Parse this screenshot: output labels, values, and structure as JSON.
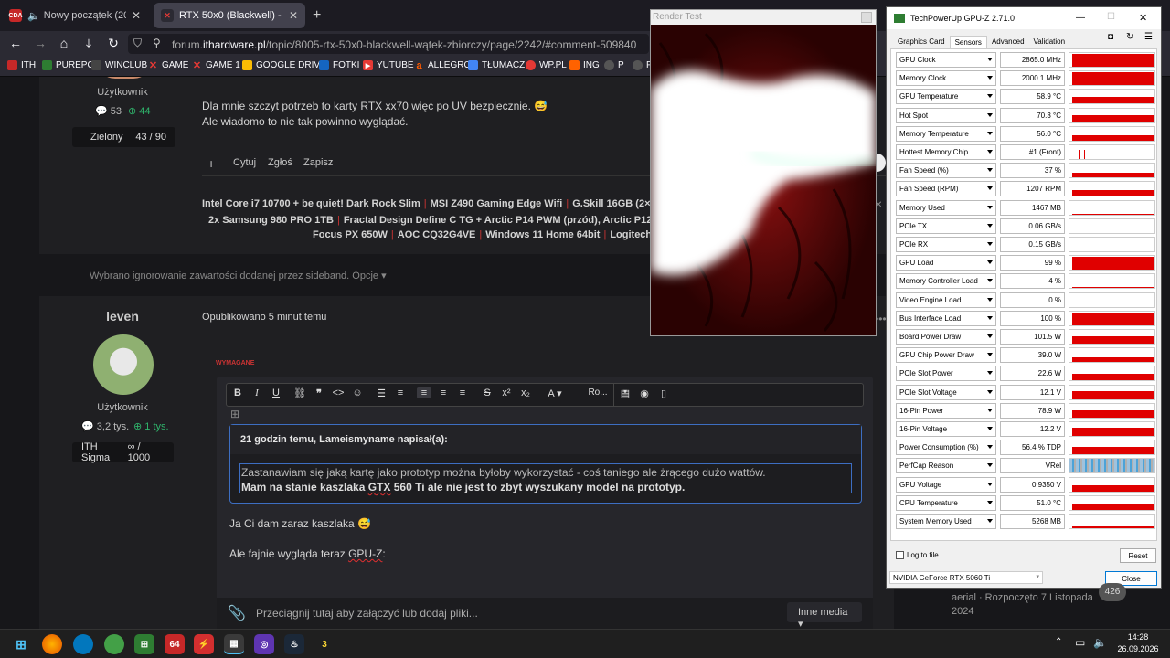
{
  "browser": {
    "tabs": [
      {
        "title": "Nowy początek (2016) [Lek",
        "fav": "CDA",
        "active": false
      },
      {
        "title": "RTX 50x0 (Blackwell) - wątek zb",
        "fav": "",
        "active": true
      }
    ],
    "url_prefix": "forum.",
    "url_domain": "ithardware.pl",
    "url_path": "/topic/8005-rtx-50x0-blackwell-wątek-zbiorczy/page/2242/#comment-509840",
    "bookmarks": [
      {
        "label": "ITH",
        "color": "#c62828"
      },
      {
        "label": "PUREPC",
        "color": "#2e7d32"
      },
      {
        "label": "WINCLUB",
        "color": "#444"
      },
      {
        "label": "GAME",
        "color": "#d32f2f"
      },
      {
        "label": "GAME 1",
        "color": "#d32f2f"
      },
      {
        "label": "GOOGLE DRIVE",
        "color": "#fbbc04"
      },
      {
        "label": "FOTKI",
        "color": "#1565c0"
      },
      {
        "label": "YUTUBE",
        "color": "#e53935"
      },
      {
        "label": "ALLEGRO",
        "color": "#ff5a00"
      },
      {
        "label": "TŁUMACZ",
        "color": "#4285f4"
      },
      {
        "label": "WP.PL",
        "color": "#e53935"
      },
      {
        "label": "ING",
        "color": "#ff6200"
      },
      {
        "label": "P",
        "color": "#555"
      },
      {
        "label": "P",
        "color": "#555"
      }
    ]
  },
  "post1": {
    "role": "Użytkownik",
    "posts": "53",
    "reputation": "44",
    "rank": "Zielony",
    "rank_progress": "43 / 90",
    "text_line1": "Dla mnie szczyt potrzeb to karty RTX xx70 więc po UV bezpiecznie. 😅",
    "text_line2": "Ale wiadomo to nie tak powinno wyglądać.",
    "actions": {
      "plus": "+",
      "quote": "Cytuj",
      "report": "Zgłoś",
      "save": "Zapisz"
    },
    "signature": [
      [
        "Intel Core i7 10700 + be quiet! Dark Rock Slim",
        "MSI Z490 Gaming Edge Wifi",
        "G.Skill 16GB (2×8GB"
      ],
      [
        "2x Samsung 980 PRO 1TB",
        "Fractal Design Define C TG + Arctic P14 PWM (przód), Arctic P12 SLI"
      ],
      [
        "Focus PX 650W",
        "AOC CQ32G4VE",
        "Windows 11 Home 64bit",
        "Logitech G1"
      ]
    ]
  },
  "ignored_notice": "Wybrano ignorowanie zawartości dodanej przez sideband. Opcje ▾",
  "post2": {
    "author": "leven",
    "posted": "Opublikowano 5 minut temu",
    "role": "Użytkownik",
    "posts": "3,2 tys.",
    "reputation": "1 tys.",
    "rank": "ITH Sigma",
    "rank_progress": "∞ / 1000",
    "required_label": "WYMAGANE",
    "font_dropdown": "Ro...",
    "quote_header": "21 godzin temu, Lameismyname napisał(a):",
    "quote_line1": "Zastanawiam się jaką kartę jako prototyp można byłoby wykorzystać - coś taniego ale żrącego dużo wattów.",
    "quote_line2_a": "Mam na stanie kaszlaka ",
    "quote_line2_gtx": "GTX",
    "quote_line2_b": " 560 Ti ale nie jest to zbyt wyszukany model na prototyp.",
    "reply_line1": "Ja Ci dam zaraz kaszlaka 😅",
    "reply_line2_a": "Ale fajnie wygląda teraz ",
    "reply_line2_gpuz": "GPU-Z",
    "reply_line2_b": ":",
    "attach_placeholder": "Przeciągnij tutaj aby załączyć lub dodaj pliki...",
    "other_media": "Inne media ▾"
  },
  "render_test": {
    "title": "Render Test"
  },
  "gpuz": {
    "title": "TechPowerUp GPU-Z 2.71.0",
    "tabs": [
      "Graphics Card",
      "Sensors",
      "Advanced",
      "Validation"
    ],
    "active_tab": "Sensors",
    "sensors": [
      {
        "label": "GPU Clock",
        "value": "2865.0 MHz",
        "fill": 0.95
      },
      {
        "label": "Memory Clock",
        "value": "2000.1 MHz",
        "fill": 0.95
      },
      {
        "label": "GPU Temperature",
        "value": "58.9 °C",
        "fill": 0.45
      },
      {
        "label": "Hot Spot",
        "value": "70.3 °C",
        "fill": 0.55
      },
      {
        "label": "Memory Temperature",
        "value": "56.0 °C",
        "fill": 0.4
      },
      {
        "label": "Hottest Memory Chip",
        "value": "#1 (Front)",
        "fill": 0.0
      },
      {
        "label": "Fan Speed (%)",
        "value": "37 %",
        "fill": 0.3
      },
      {
        "label": "Fan Speed (RPM)",
        "value": "1207 RPM",
        "fill": 0.4
      },
      {
        "label": "Memory Used",
        "value": "1467 MB",
        "fill": 0.08
      },
      {
        "label": "PCIe TX",
        "value": "0.06 GB/s",
        "fill": 0.0
      },
      {
        "label": "PCIe RX",
        "value": "0.15 GB/s",
        "fill": 0.0
      },
      {
        "label": "GPU Load",
        "value": "99 %",
        "fill": 0.9
      },
      {
        "label": "Memory Controller Load",
        "value": "4 %",
        "fill": 0.05
      },
      {
        "label": "Video Engine Load",
        "value": "0 %",
        "fill": 0.0
      },
      {
        "label": "Bus Interface Load",
        "value": "100 %",
        "fill": 0.95
      },
      {
        "label": "Board Power Draw",
        "value": "101.5 W",
        "fill": 0.55
      },
      {
        "label": "GPU Chip Power Draw",
        "value": "39.0 W",
        "fill": 0.35
      },
      {
        "label": "PCIe Slot Power",
        "value": "22.6 W",
        "fill": 0.45
      },
      {
        "label": "PCIe Slot Voltage",
        "value": "12.1 V",
        "fill": 0.6
      },
      {
        "label": "16-Pin Power",
        "value": "78.9 W",
        "fill": 0.5
      },
      {
        "label": "16-Pin Voltage",
        "value": "12.2 V",
        "fill": 0.6
      },
      {
        "label": "Power Consumption (%)",
        "value": "56.4 % TDP",
        "fill": 0.55
      },
      {
        "label": "PerfCap Reason",
        "value": "VRel",
        "fill": 0.0
      },
      {
        "label": "GPU Voltage",
        "value": "0.9350 V",
        "fill": 0.45
      },
      {
        "label": "CPU Temperature",
        "value": "51.0 °C",
        "fill": 0.4
      },
      {
        "label": "System Memory Used",
        "value": "5268 MB",
        "fill": 0.15
      }
    ],
    "log_to_file": "Log to file",
    "reset": "Reset",
    "gpu_select": "NVIDIA GeForce RTX 5060 Ti",
    "close": "Close"
  },
  "background_right": {
    "line1": "aerial · Rozpoczęto 7 Listopada",
    "line2": "2024",
    "badge": "426"
  },
  "taskbar": {
    "time": "14:28",
    "date": "26.09.2026"
  }
}
